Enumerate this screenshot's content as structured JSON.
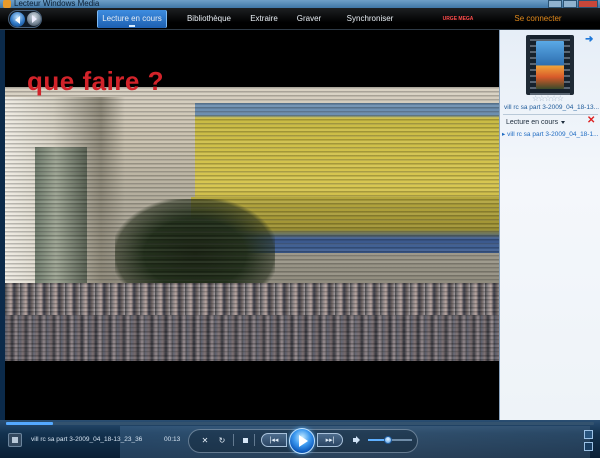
{
  "window": {
    "title": "Lecteur Windows Media"
  },
  "nav": {
    "tabs": [
      {
        "label": "Lecture en cours",
        "active": true
      },
      {
        "label": "Bibliothèque"
      },
      {
        "label": "Extraire"
      },
      {
        "label": "Graver"
      },
      {
        "label": "Synchroniser"
      }
    ],
    "brand": "URGE MEGA",
    "connect": "Se connecter"
  },
  "video": {
    "overlay_text": "que faire ?"
  },
  "playlist": {
    "rating": "☆☆☆☆☆",
    "now_playing_title": "vill rc sa part 3-2009_04_18-13...",
    "header": "Lecture en cours",
    "items": [
      "vill rc sa part 3-2009_04_18-1..."
    ]
  },
  "controls": {
    "status_text": "vill rc sa part 3-2009_04_18-13_23_36",
    "time": "00:13",
    "progress": 0.08,
    "volume": 0.45
  },
  "colors": {
    "overlay_text": "#d2232a",
    "accent": "#3e8de0",
    "connect": "#e38a1a"
  }
}
